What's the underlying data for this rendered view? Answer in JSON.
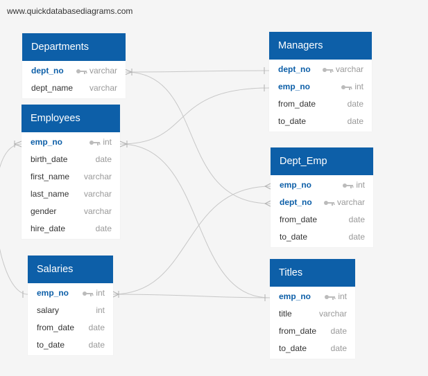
{
  "watermark": "www.quickdatabasediagrams.com",
  "colors": {
    "header": "#0d5fa8",
    "key_text": "#0d5fa8",
    "line": "#c7c7c7"
  },
  "tables": {
    "departments": {
      "title": "Departments",
      "fields": [
        {
          "name": "dept_no",
          "type": "varchar",
          "pk": true
        },
        {
          "name": "dept_name",
          "type": "varchar",
          "pk": false
        }
      ]
    },
    "employees": {
      "title": "Employees",
      "fields": [
        {
          "name": "emp_no",
          "type": "int",
          "pk": true
        },
        {
          "name": "birth_date",
          "type": "date",
          "pk": false
        },
        {
          "name": "first_name",
          "type": "varchar",
          "pk": false
        },
        {
          "name": "last_name",
          "type": "varchar",
          "pk": false
        },
        {
          "name": "gender",
          "type": "varchar",
          "pk": false
        },
        {
          "name": "hire_date",
          "type": "date",
          "pk": false
        }
      ]
    },
    "salaries": {
      "title": "Salaries",
      "fields": [
        {
          "name": "emp_no",
          "type": "int",
          "pk": true
        },
        {
          "name": "salary",
          "type": "int",
          "pk": false
        },
        {
          "name": "from_date",
          "type": "date",
          "pk": false
        },
        {
          "name": "to_date",
          "type": "date",
          "pk": false
        }
      ]
    },
    "managers": {
      "title": "Managers",
      "fields": [
        {
          "name": "dept_no",
          "type": "varchar",
          "pk": true
        },
        {
          "name": "emp_no",
          "type": "int",
          "pk": true
        },
        {
          "name": "from_date",
          "type": "date",
          "pk": false
        },
        {
          "name": "to_date",
          "type": "date",
          "pk": false
        }
      ]
    },
    "dept_emp": {
      "title": "Dept_Emp",
      "fields": [
        {
          "name": "emp_no",
          "type": "int",
          "pk": true
        },
        {
          "name": "dept_no",
          "type": "varchar",
          "pk": true
        },
        {
          "name": "from_date",
          "type": "date",
          "pk": false
        },
        {
          "name": "to_date",
          "type": "date",
          "pk": false
        }
      ]
    },
    "titles": {
      "title": "Titles",
      "fields": [
        {
          "name": "emp_no",
          "type": "int",
          "pk": true
        },
        {
          "name": "title",
          "type": "varchar",
          "pk": false
        },
        {
          "name": "from_date",
          "type": "date",
          "pk": false
        },
        {
          "name": "to_date",
          "type": "date",
          "pk": false
        }
      ]
    }
  }
}
